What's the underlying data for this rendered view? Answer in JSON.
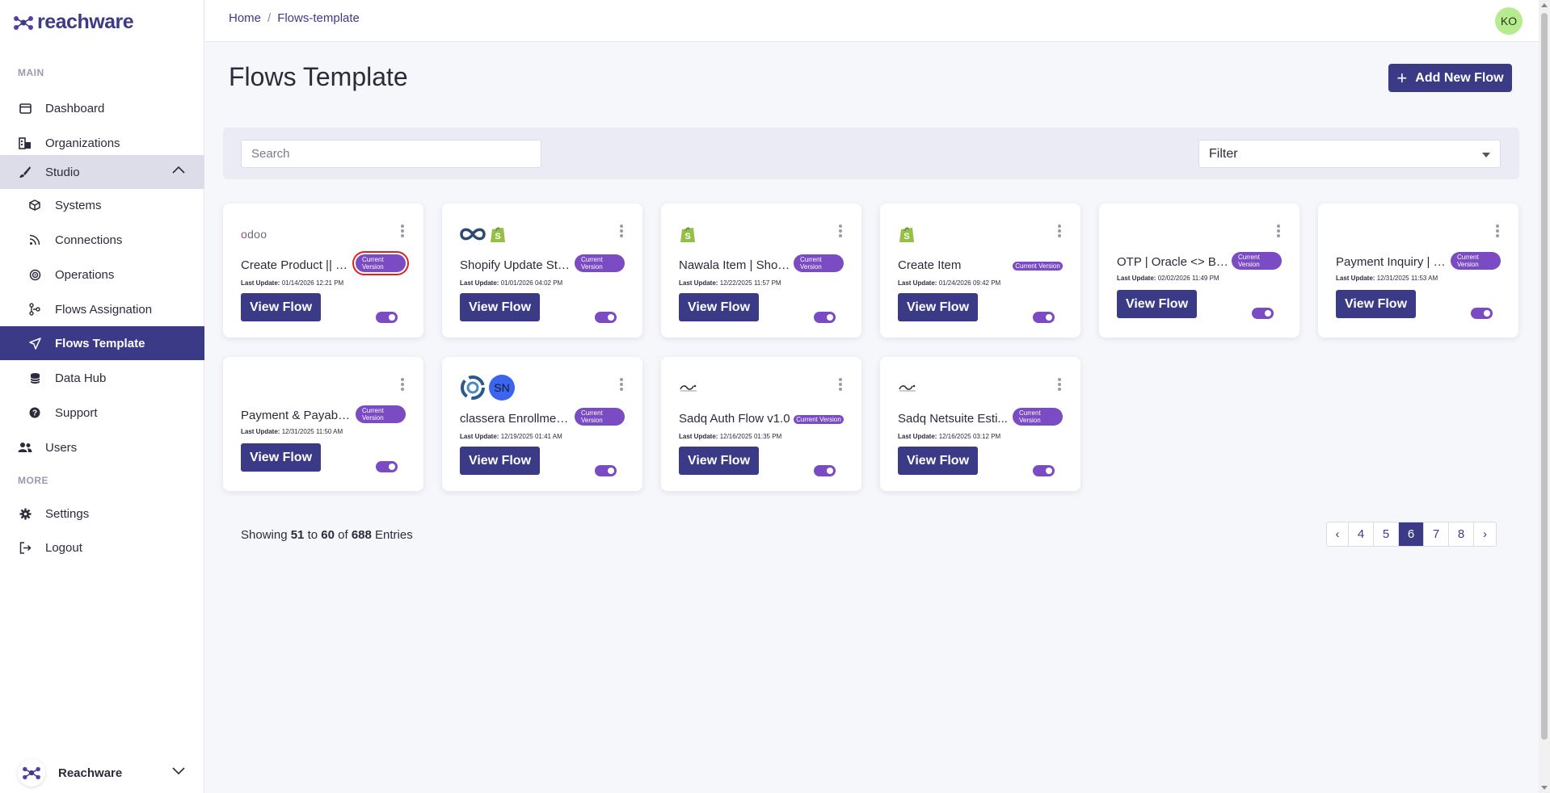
{
  "app": {
    "logo_text": "reachware"
  },
  "header": {
    "breadcrumb": [
      "Home",
      "Flows-template"
    ],
    "breadcrumb_separator": "/",
    "avatar_initials": "KO"
  },
  "sidebar": {
    "section_main": "MAIN",
    "section_more": "MORE",
    "items": [
      {
        "label": "Dashboard",
        "icon": "dashboard-icon"
      },
      {
        "label": "Organizations",
        "icon": "organizations-icon"
      },
      {
        "label": "Studio",
        "icon": "brush-icon",
        "expanded": true
      },
      {
        "label": "Systems",
        "icon": "box-icon"
      },
      {
        "label": "Connections",
        "icon": "rss-icon"
      },
      {
        "label": "Operations",
        "icon": "target-icon"
      },
      {
        "label": "Flows Assignation",
        "icon": "flows-assign-icon"
      },
      {
        "label": "Flows Template",
        "icon": "send-icon",
        "active": true
      },
      {
        "label": "Data Hub",
        "icon": "database-icon"
      },
      {
        "label": "Support",
        "icon": "help-icon"
      },
      {
        "label": "Users",
        "icon": "users-icon"
      },
      {
        "label": "Settings",
        "icon": "gear-icon"
      },
      {
        "label": "Logout",
        "icon": "logout-icon"
      }
    ],
    "org_name": "Reachware"
  },
  "page": {
    "title": "Flows Template",
    "add_button_label": "Add New Flow",
    "search_placeholder": "Search",
    "filter_label": "Filter"
  },
  "cards": [
    {
      "title": "Create Product || S...",
      "badge": [
        "Current",
        "Version"
      ],
      "update_label": "Last Update:",
      "update": "01/14/2026 12:21 PM",
      "button": "View Flow",
      "icons": [
        "odoo-logo"
      ],
      "enabled": true
    },
    {
      "title": "Shopify Update Sto...",
      "badge": [
        "Current",
        "Version"
      ],
      "update_label": "Last Update:",
      "update": "01/01/2026 04:02 PM",
      "button": "View Flow",
      "icons": [
        "infinity-logo",
        "shopify-logo"
      ],
      "enabled": true
    },
    {
      "title": "Nawala Item | Shop...",
      "badge": [
        "Current",
        "Version"
      ],
      "update_label": "Last Update:",
      "update": "12/22/2025 11:57 PM",
      "button": "View Flow",
      "icons": [
        "shopify-logo"
      ],
      "enabled": true
    },
    {
      "title": "Create Item",
      "badge": [
        "Current Version"
      ],
      "update_label": "Last Update:",
      "update": "01/24/2026 09:42 PM",
      "button": "View Flow",
      "icons": [
        "shopify-logo"
      ],
      "enabled": true
    },
    {
      "title": "OTP | Oracle <> Baw...",
      "badge": [
        "Current",
        "Version"
      ],
      "update_label": "Last Update:",
      "update": "02/02/2026 11:49 PM",
      "button": "View Flow",
      "icons": [],
      "enabled": true
    },
    {
      "title": "Payment Inquiry | O...",
      "badge": [
        "Current",
        "Version"
      ],
      "update_label": "Last Update:",
      "update": "12/31/2025 11:53 AM",
      "button": "View Flow",
      "icons": [],
      "enabled": true
    },
    {
      "title": "Payment & Payable...",
      "badge": [
        "Current",
        "Version"
      ],
      "update_label": "Last Update:",
      "update": "12/31/2025 11:50 AM",
      "button": "View Flow",
      "icons": [],
      "enabled": true
    },
    {
      "title": "classera Enrollment...",
      "badge": [
        "Current",
        "Version"
      ],
      "update_label": "Last Update:",
      "update": "12/19/2025 01:41 AM",
      "button": "View Flow",
      "icons": [
        "classera-logo",
        "sn-avatar"
      ],
      "icon_text": "SN",
      "enabled": true
    },
    {
      "title": "Sadq Auth Flow v1.0",
      "badge": [
        "Current Version"
      ],
      "update_label": "Last Update:",
      "update": "12/16/2025 01:35 PM",
      "button": "View Flow",
      "icons": [
        "sadq-logo"
      ],
      "enabled": true
    },
    {
      "title": "Sadq Netsuite Esti...",
      "badge": [
        "Current",
        "Version"
      ],
      "update_label": "Last Update:",
      "update": "12/16/2025 03:12 PM",
      "button": "View Flow",
      "icons": [
        "sadq-logo"
      ],
      "enabled": true
    }
  ],
  "pagination": {
    "showing_prefix": "Showing",
    "from": "51",
    "to_word": "to",
    "to": "60",
    "of_word": "of",
    "total": "688",
    "suffix": "Entries",
    "prev": "‹",
    "next": "›",
    "pages": [
      "4",
      "5",
      "6",
      "7",
      "8"
    ],
    "current": "6"
  },
  "colors": {
    "primary": "#3a3a86",
    "badge": "#7a4bc2",
    "avatar": "#b6ec8f",
    "shopify": "#95bf47"
  }
}
